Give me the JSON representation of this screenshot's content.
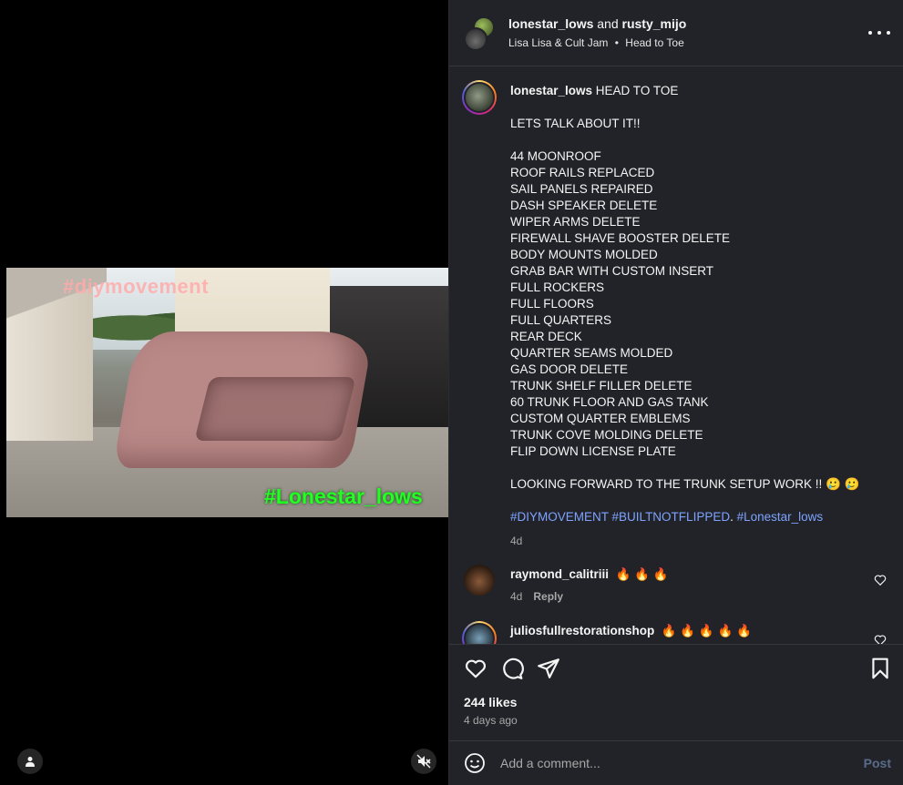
{
  "media": {
    "overlay_top": "#diymovement",
    "overlay_bottom": "#Lonestar_lows",
    "user_tag_icon": "person-icon",
    "mute_icon": "speaker-muted-icon"
  },
  "header": {
    "user1": "lonestar_lows",
    "joiner": " and ",
    "user2": "rusty_mijo",
    "audio_artist": "Lisa Lisa & Cult Jam",
    "audio_separator": "•",
    "audio_title": "Head to Toe",
    "more_icon": "more-horizontal-icon"
  },
  "caption": {
    "username": "lonestar_lows",
    "title": "HEAD TO TOE",
    "lines": [
      "LETS TALK ABOUT IT!!",
      "",
      "44 MOONROOF",
      "ROOF RAILS REPLACED",
      "SAIL PANELS REPAIRED",
      "DASH SPEAKER DELETE",
      "WIPER ARMS DELETE",
      "FIREWALL SHAVE BOOSTER DELETE",
      "BODY MOUNTS MOLDED",
      "GRAB BAR WITH CUSTOM INSERT",
      "FULL ROCKERS",
      "FULL FLOORS",
      "FULL QUARTERS",
      "REAR DECK",
      "QUARTER SEAMS MOLDED",
      "GAS DOOR DELETE",
      "TRUNK SHELF FILLER DELETE",
      "60 TRUNK FLOOR AND GAS TANK",
      "CUSTOM QUARTER EMBLEMS",
      "TRUNK COVE MOLDING DELETE",
      "FLIP DOWN LICENSE PLATE",
      "",
      "LOOKING FORWARD TO THE TRUNK SETUP WORK !! 🥲 🥲",
      ""
    ],
    "hashtag1": "#DIYMOVEMENT",
    "hashtag2": "#BUILTNOTFLIPPED",
    "hashtag_sep": ". ",
    "hashtag3": "#Lonestar_lows",
    "time": "4d"
  },
  "comments": [
    {
      "username": "raymond_calitriii",
      "text": "🔥 🔥 🔥",
      "time": "4d",
      "reply_label": "Reply"
    },
    {
      "username": "juliosfullrestorationshop",
      "text": "🔥 🔥 🔥 🔥 🔥"
    }
  ],
  "actions": {
    "like_icon": "heart-icon",
    "comment_icon": "comment-bubble-icon",
    "share_icon": "paper-plane-icon",
    "save_icon": "bookmark-icon",
    "likes_text": "244 likes",
    "post_date": "4 days ago"
  },
  "comment_box": {
    "placeholder": "Add a comment...",
    "post_label": "Post",
    "emoji_icon": "smiley-icon"
  },
  "colors": {
    "panel_bg": "#212328",
    "hashtag": "#7ea3ff",
    "post_button_disabled": "#5a6b8a"
  }
}
